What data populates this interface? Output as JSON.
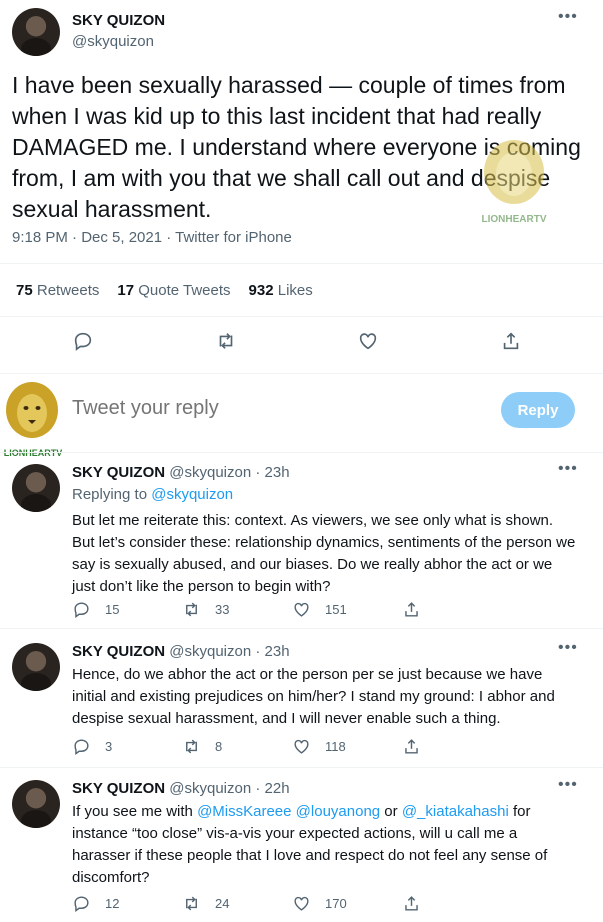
{
  "main_tweet": {
    "name": "SKY QUIZON",
    "handle": "@skyquizon",
    "text": "I have been sexually harassed — couple of times from when I was kid up  to this last incident that had really DAMAGED me. I understand where everyone is coming from, I am with you that we shall call out and despise sexual harassment.",
    "meta": "9:18 PM · Dec 5, 2021 · Twitter for iPhone",
    "stats": {
      "retweets_count": "75",
      "retweets_label": "Retweets",
      "quotes_count": "17",
      "quotes_label": "Quote Tweets",
      "likes_count": "932",
      "likes_label": "Likes"
    }
  },
  "watermark_text": "LIONHEARTV",
  "reply_box": {
    "placeholder": "Tweet your reply",
    "button_label": "Reply"
  },
  "replies": [
    {
      "name": "SKY QUIZON",
      "handle": "@skyquizon · 23h",
      "replying_prefix": "Replying to ",
      "replying_to": "@skyquizon",
      "text": "But let me reiterate this: context. As viewers, we see only what is shown. But let’s consider these: relationship dynamics, sentiments of the person we say is sexually abused, and our biases. Do we really abhor the act or we just don’t like the person to begin with?",
      "reply_count": "15",
      "retweet_count": "33",
      "like_count": "151"
    },
    {
      "name": "SKY QUIZON",
      "handle": "@skyquizon · 23h",
      "text": "Hence, do we abhor the act or the person per se just because we have initial and existing prejudices on him/her? I stand my ground: I abhor and despise sexual harassment, and I will never enable such a thing.",
      "reply_count": "3",
      "retweet_count": "8",
      "like_count": "118"
    },
    {
      "name": "SKY QUIZON",
      "handle": "@skyquizon · 22h",
      "text_part1": "If you see me with ",
      "mention1": "@MissKareee",
      "text_part2": " ",
      "mention2": "@louyanong",
      "text_part3": " or ",
      "mention3": "@_kiatakahashi",
      "text_part4": " for instance “too close” vis-a-vis your expected actions, will u call me a harasser if these people that I love and respect do not feel any sense of discomfort?",
      "reply_count": "12",
      "retweet_count": "24",
      "like_count": "170"
    }
  ],
  "colors": {
    "accent": "#1d9bf0",
    "reply_button": "#8ecdf8",
    "muted": "#536471",
    "lion_gold": "#c9a227",
    "lion_green": "#2e7d32"
  },
  "icons": [
    "more-icon",
    "reply-icon",
    "retweet-icon",
    "like-icon",
    "share-icon",
    "lion-logo"
  ]
}
